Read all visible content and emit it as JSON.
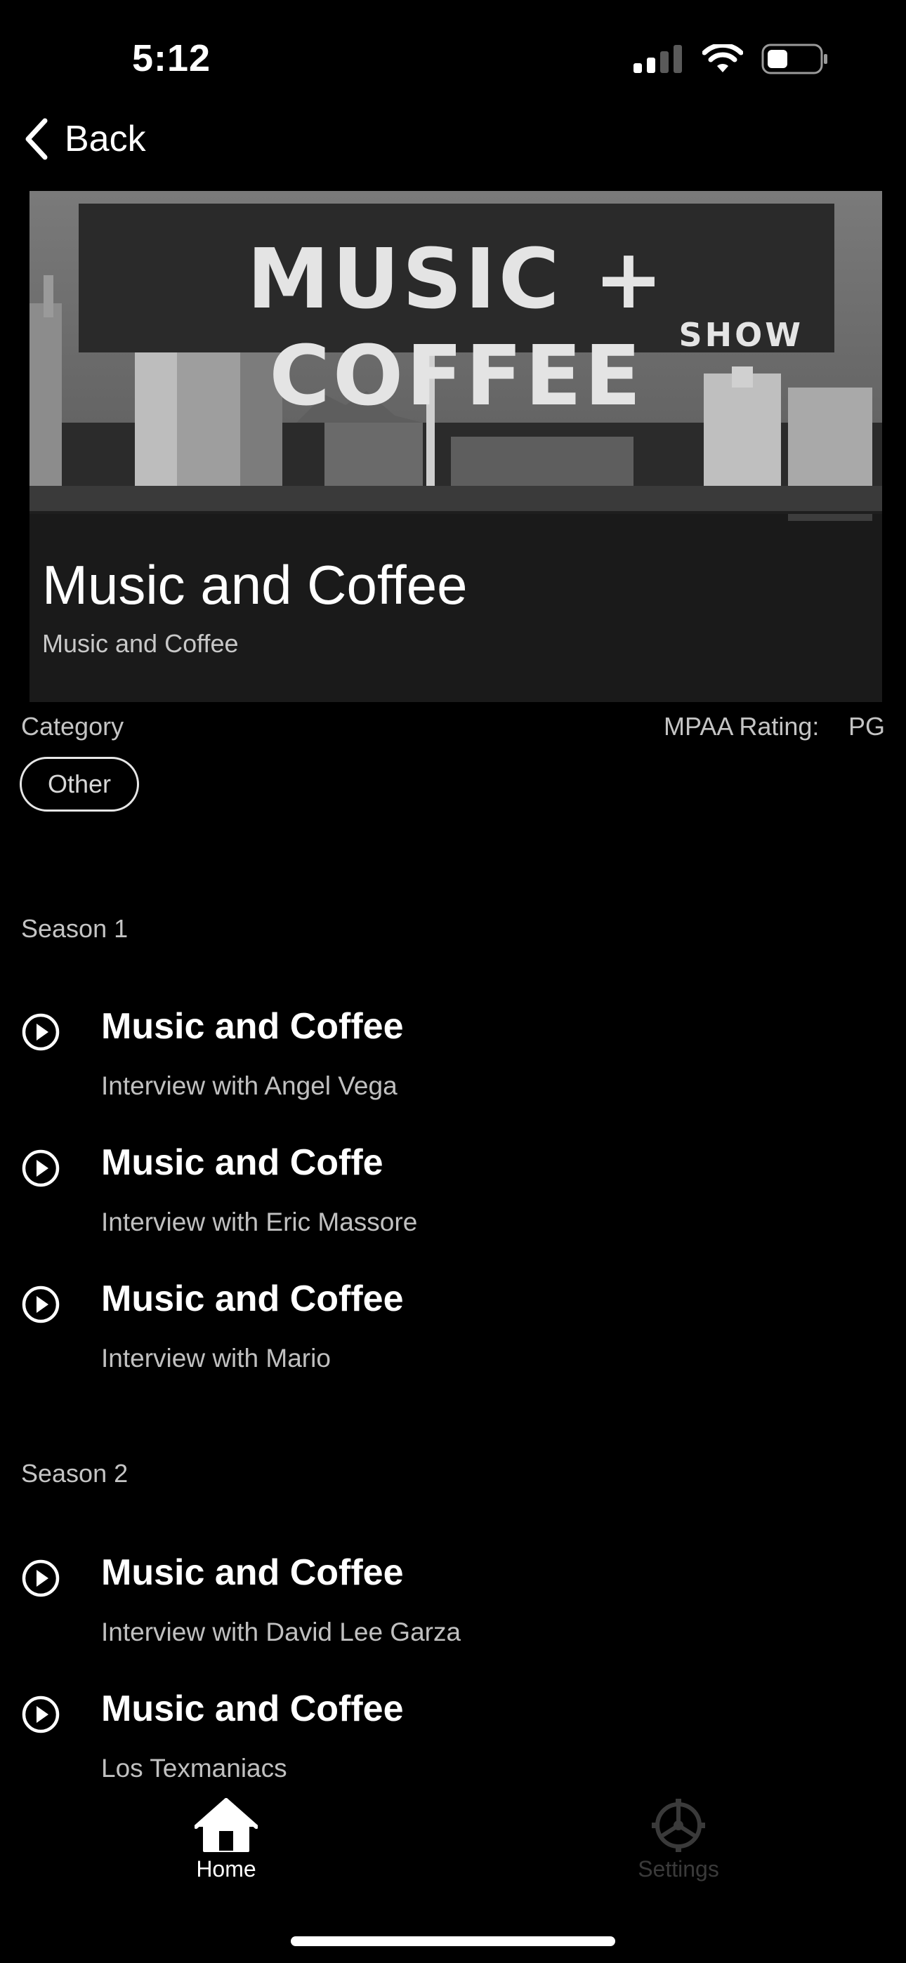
{
  "status_bar": {
    "time": "5:12",
    "icons": [
      "cellular-signal-icon",
      "wifi-icon",
      "battery-icon"
    ]
  },
  "nav": {
    "back_label": "Back"
  },
  "hero": {
    "logo_text": "MUSIC + COFFEE",
    "logo_subtext": "SHOW",
    "title": "Music and Coffee",
    "subtitle": "Music and Coffee"
  },
  "details": {
    "category_label": "Category",
    "category_value": "Other",
    "mpaa_label": "MPAA Rating:",
    "mpaa_value": "PG"
  },
  "seasons": [
    {
      "label": "Season 1",
      "episodes": [
        {
          "title": "Music and Coffee",
          "description": "Interview with Angel Vega"
        },
        {
          "title": "Music and Coffe",
          "description": "Interview with Eric Massore"
        },
        {
          "title": "Music and Coffee",
          "description": "Interview with Mario"
        }
      ]
    },
    {
      "label": "Season 2",
      "episodes": [
        {
          "title": "Music and Coffee",
          "description": "Interview with David Lee Garza"
        },
        {
          "title": "Music and Coffee",
          "description": "Los Texmaniacs"
        }
      ]
    }
  ],
  "tab_bar": {
    "home_label": "Home",
    "settings_label": "Settings",
    "active_color": "#ffffff",
    "inactive_color": "#3a3a3a"
  }
}
